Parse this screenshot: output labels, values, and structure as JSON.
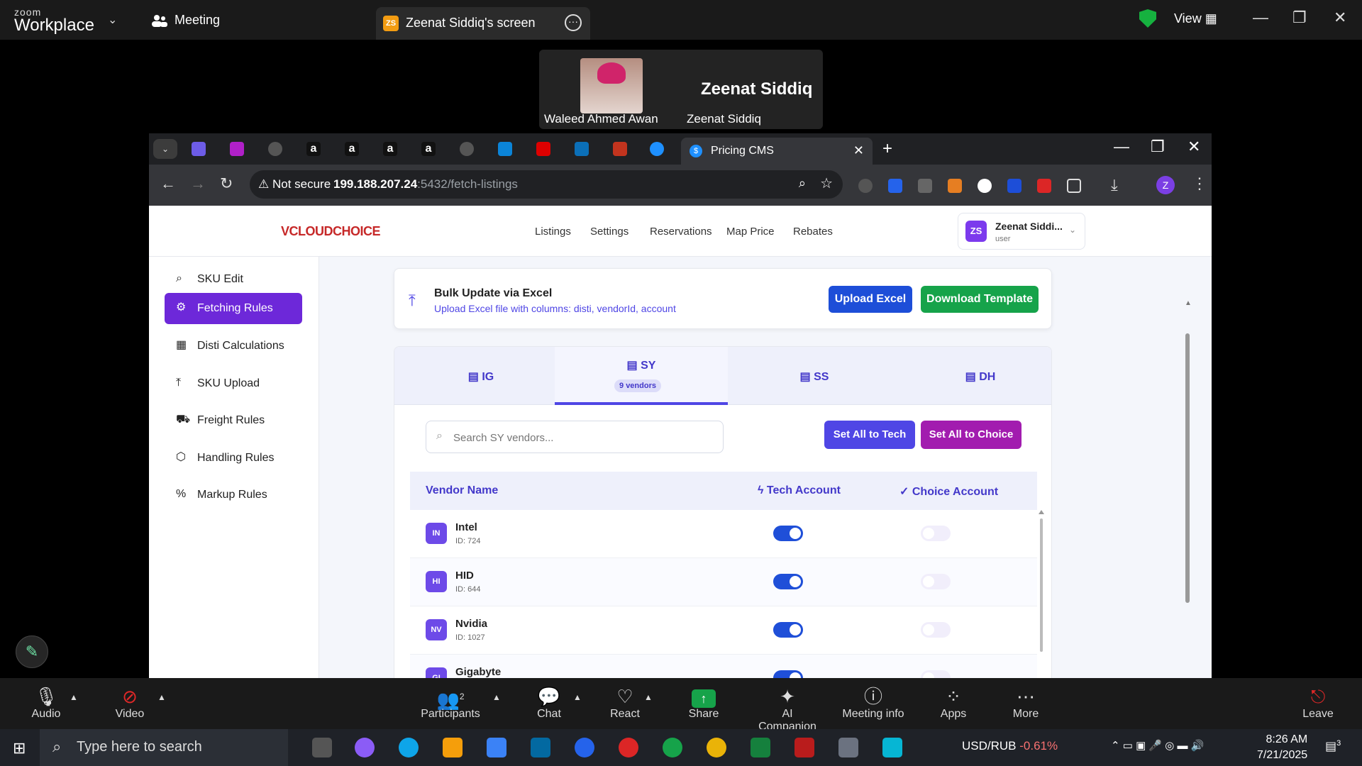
{
  "zoom": {
    "brand_top": "zoom",
    "brand_bottom": "Workplace",
    "meeting_label": "Meeting",
    "share_tab_initials": "ZS",
    "share_tab_label": "Zeenat Siddiq's screen",
    "view_label": "View",
    "participant1": "Waleed Ahmed Awan",
    "participant2_big": "Zeenat Siddiq",
    "participant2": "Zeenat Siddiq",
    "toolbar": {
      "audio": "Audio",
      "video": "Video",
      "participants": "Participants",
      "participants_count": "2",
      "chat": "Chat",
      "react": "React",
      "share": "Share",
      "ai": "AI Companion",
      "info": "Meeting info",
      "apps": "Apps",
      "more": "More",
      "leave": "Leave"
    }
  },
  "browser": {
    "active_tab": "Pricing CMS",
    "not_secure": "Not secure",
    "url_host": "199.188.207.24",
    "url_path": ":5432/fetch-listings",
    "profile_initial": "Z"
  },
  "app": {
    "logo": "VCLOUDCHOICE",
    "nav": [
      "Listings",
      "Settings",
      "Reservations",
      "Map Price",
      "Rebates"
    ],
    "user": {
      "initials": "ZS",
      "name": "Zeenat Siddi...",
      "role": "user"
    },
    "sidebar": [
      {
        "label": "SKU Edit",
        "icon": "search-icon",
        "glyph": "⌕"
      },
      {
        "label": "Fetching Rules",
        "icon": "gear-icon",
        "glyph": "⚙"
      },
      {
        "label": "Disti Calculations",
        "icon": "calculator-icon",
        "glyph": "▦"
      },
      {
        "label": "SKU Upload",
        "icon": "upload-icon",
        "glyph": "⤒"
      },
      {
        "label": "Freight Rules",
        "icon": "truck-icon",
        "glyph": "⛟"
      },
      {
        "label": "Handling Rules",
        "icon": "box-icon",
        "glyph": "⬡"
      },
      {
        "label": "Markup Rules",
        "icon": "percent-icon",
        "glyph": "%"
      }
    ],
    "bulk": {
      "title": "Bulk Update via Excel",
      "subtitle": "Upload Excel file with columns: disti, vendorId, account",
      "upload_btn": "Upload Excel",
      "template_btn": "Download Template"
    },
    "tabs": [
      {
        "label": "IG"
      },
      {
        "label": "SY",
        "sub": "9 vendors"
      },
      {
        "label": "SS"
      },
      {
        "label": "DH"
      }
    ],
    "search_placeholder": "Search SY vendors...",
    "set_tech_btn": "Set All to Tech",
    "set_choice_btn": "Set All to Choice",
    "columns": {
      "vendor": "Vendor Name",
      "tech": "Tech Account",
      "choice": "Choice Account"
    },
    "vendors": [
      {
        "initials": "IN",
        "name": "Intel",
        "id": "ID: 724",
        "tech": true,
        "choice": false
      },
      {
        "initials": "HI",
        "name": "HID",
        "id": "ID: 644",
        "tech": true,
        "choice": false
      },
      {
        "initials": "NV",
        "name": "Nvidia",
        "id": "ID: 1027",
        "tech": true,
        "choice": false
      },
      {
        "initials": "GI",
        "name": "Gigabyte",
        "id": "",
        "tech": true,
        "choice": false
      }
    ],
    "colors": {
      "accent": "#6d28d9",
      "tech_btn": "#4f46e5",
      "choice_btn": "#a21caf",
      "green": "#16a34a",
      "upload_blue": "#1d4ed8"
    }
  },
  "taskbar": {
    "search_placeholder": "Type here to search",
    "ticker_name": "USD/RUB",
    "ticker_value": "-0.61%",
    "time": "8:26 AM",
    "date": "7/21/2025",
    "notifications": "3"
  }
}
